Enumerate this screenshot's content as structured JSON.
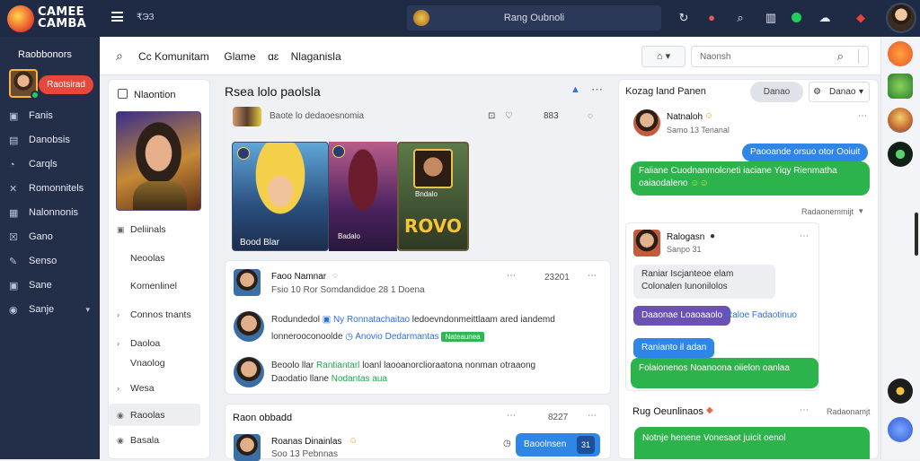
{
  "app": {
    "logo_line1": "CAMEE",
    "logo_line2": "CAMBA",
    "top_text": "₹ЭЗ",
    "search_text": "Rang Oubnoli",
    "accent": "#2f86e6",
    "topbar_color": "#1f2a44"
  },
  "sidebar": {
    "title": "Raobbonors",
    "pill": "Raotsirad",
    "items": [
      {
        "icon": "▣",
        "label": "Fanis"
      },
      {
        "icon": "▤",
        "label": "Danobsis"
      },
      {
        "icon": "◔",
        "label": "Carqls"
      },
      {
        "icon": "✕",
        "label": "Romonnitels"
      },
      {
        "icon": "▦",
        "label": "Nalonnonis"
      },
      {
        "icon": "☒",
        "label": "Gano"
      },
      {
        "icon": "✎",
        "label": "Senso"
      },
      {
        "icon": "▣",
        "label": "Sane"
      },
      {
        "icon": "◉",
        "label": "Sanje",
        "caret": "▾"
      }
    ]
  },
  "header": {
    "crumb": "Cc Komunitam",
    "crumb2": "Glame",
    "crumb3": "ɑɛ",
    "crumb4": "Nlaganisla",
    "btn": "⌂ ▾",
    "search_placeholder": "Naonsh"
  },
  "nav": {
    "heading": "Nlaontion",
    "items": [
      {
        "arrow": "▣",
        "label": "Deliinals"
      },
      {
        "arrow": "",
        "label": "Neoolas"
      },
      {
        "arrow": "",
        "label": "Komenlinel"
      },
      {
        "arrow": "›",
        "label": "Connos tnants"
      },
      {
        "arrow": "›",
        "label": "Daoloa"
      },
      {
        "arrow": "",
        "label": "Vnaolog"
      },
      {
        "arrow": "›",
        "label": "Wesa"
      },
      {
        "arrow": "◉",
        "label": "Raoolas"
      },
      {
        "arrow": "◉",
        "label": "Basala"
      }
    ]
  },
  "feed": {
    "title": "Rsea lolo paolsla",
    "meta": "Baote lo dedaoesnomia",
    "stat": "883",
    "art1_label": "Bood Blar",
    "art2_label": "Badalo",
    "art3_small": "Bndalo",
    "art3_big": "ROVO"
  },
  "post1": {
    "name": "Faoo Namnar",
    "sub": "Fsio 10 Ror Somdandidoe 28 1 Doena",
    "count": "23201",
    "l1a": "Rodundedol",
    "l1b": "Ny Ronnatachaitao",
    "l1c": "ledoevndonmeittlaam ared iandemd",
    "l2a": "lonnerooconoolde",
    "l2b": "Anovio Dedarmantas",
    "l2tag": "Nateaunea",
    "l3a": "Beoolo llar",
    "l3b": "Rantiantarl",
    "l3c": "loanl laooanorclioraatona nonman otraaong",
    "l4a": "Daodatio llane",
    "l4b": "Nodantas aua"
  },
  "post2": {
    "title": "Raon obbadd",
    "count": "8227",
    "name": "Roanas Dinainlas",
    "sub": "Soo 13 Pebnnas",
    "btn": "Baoolnsen",
    "btn_count": "31"
  },
  "chat": {
    "title": "Kozag land Panen",
    "pill": "Danao",
    "select": "Danao",
    "u1_name": "Natnaloh",
    "u1_sub": "Samo 13 Tenanal",
    "b1": "Paooande orsuo otor Ooiuit",
    "b2a": "Faiiane Cuodnanmolcneti iaciane Yiqy Rienmatha",
    "b2b": "oaiaodaleno",
    "time1": "Radaonemmijt",
    "u2_name": "Ralogasn",
    "u2_sub": "Sanpo 31",
    "b3a": "Raniar Iscjanteoe elam",
    "b3b": "Colonalen Iunonilolos",
    "b4": "Daaonae Loaoaaolo",
    "b4link": "Raloe Fadaotinuo",
    "b5": "Ranianto il adan",
    "b6": "Folaionenos Noanoona oiielon oanlaa",
    "u3_name": "Rug Oeunlinaos",
    "time2": "Radaonamjt",
    "b7": "Notnje henene Vonesaot juicit oenol"
  }
}
